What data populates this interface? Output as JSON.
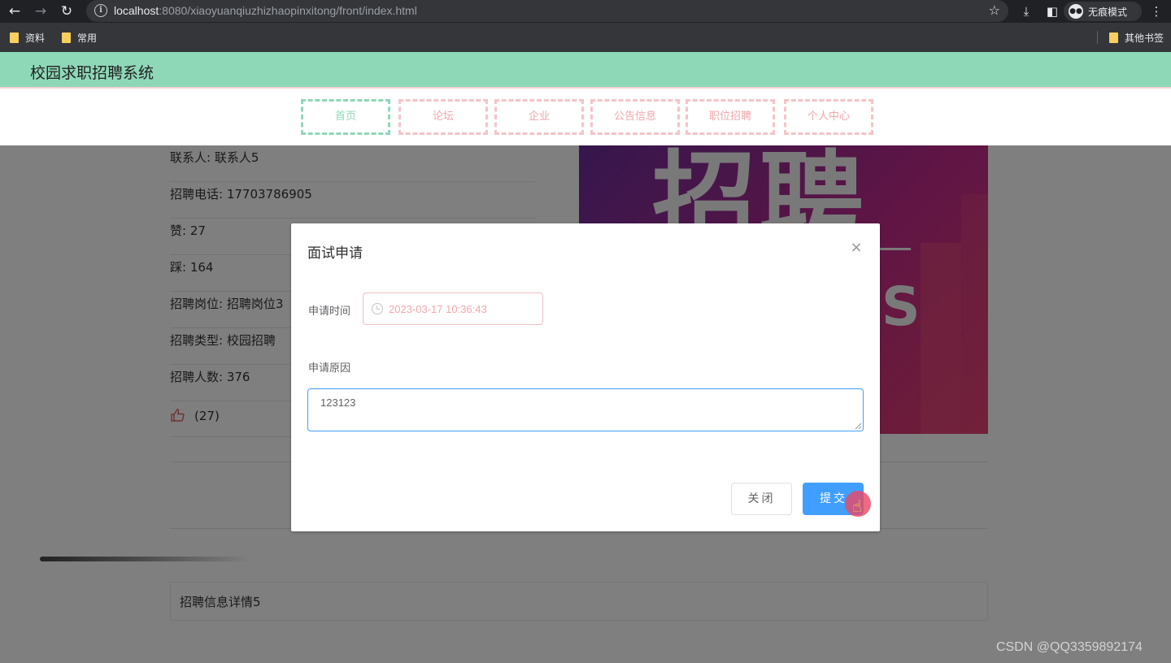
{
  "browser": {
    "url_host": "localhost",
    "url_rest": ":8080/xiaoyuanqiuzhizhaopinxitong/front/index.html",
    "incognito_label": "无痕模式",
    "bookmarks": [
      "资料",
      "常用"
    ],
    "other_bookmarks": "其他书签"
  },
  "site": {
    "title": "校园求职招聘系统",
    "nav": [
      "首页",
      "论坛",
      "企业",
      "公告信息",
      "职位招聘",
      "个人中心"
    ],
    "active_nav": "首页"
  },
  "job": {
    "rows": [
      "联系人: 联系人5",
      "招聘电话: 17703786905",
      "赞: 27",
      "踩: 164",
      "招聘岗位: 招聘岗位3",
      "招聘类型: 校园招聘",
      "招聘人数: 376"
    ],
    "like_count": "(27)",
    "poster_text": "招聘",
    "poster_letter": "S",
    "detail_tab": "招聘信息详情5"
  },
  "dialog": {
    "title": "面试申请",
    "time_label": "申请时间",
    "time_value": "2023-03-17 10:36:43",
    "reason_label": "申请原因",
    "reason_value": "123123",
    "close_label": "关闭",
    "submit_label": "提交"
  },
  "watermark": "CSDN @QQ3359892174",
  "colors": {
    "header_green": "#8ed8b8",
    "nav_pink": "#f5c4c6",
    "primary_blue": "#409eff"
  }
}
